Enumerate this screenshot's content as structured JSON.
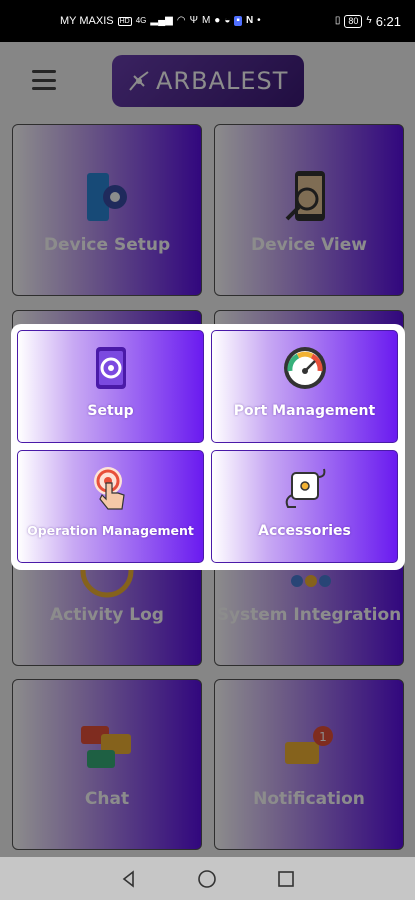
{
  "status_bar": {
    "carrier": "MY MAXIS",
    "network": "4G",
    "battery": "80",
    "time": "6:21",
    "icons": [
      "hd-icon",
      "signal-icon",
      "wifi-icon",
      "usb-icon",
      "mail-icon",
      "messenger-icon",
      "app-icon",
      "netflix-icon",
      "vibrate-icon",
      "charging-icon"
    ]
  },
  "header": {
    "logo_text": "ARBALEST",
    "menu_icon": "hamburger-menu-icon"
  },
  "grid": {
    "tiles": [
      {
        "label": "Device Setup",
        "icon": "device-setup-icon"
      },
      {
        "label": "Device View",
        "icon": "device-view-icon"
      },
      {
        "label": "Activity Log",
        "icon": "activity-log-icon"
      },
      {
        "label": "System Integration",
        "icon": "system-integration-icon"
      },
      {
        "label": "Chat",
        "icon": "chat-icon"
      },
      {
        "label": "Notification",
        "icon": "notification-icon"
      }
    ]
  },
  "popup": {
    "tiles": [
      {
        "label": "Setup",
        "icon": "phone-gear-icon"
      },
      {
        "label": "Port Management",
        "icon": "gauge-icon"
      },
      {
        "label": "Operation Management",
        "icon": "touch-target-icon"
      },
      {
        "label": "Accessories",
        "icon": "cable-device-icon"
      }
    ]
  },
  "colors": {
    "tile_gradient_end": "#5b0ee6",
    "popup_gradient_end": "#6a1bf0",
    "logo_bg": "#4d2590"
  },
  "nav": {
    "back": "back-icon",
    "home": "home-icon",
    "recents": "recents-icon"
  }
}
